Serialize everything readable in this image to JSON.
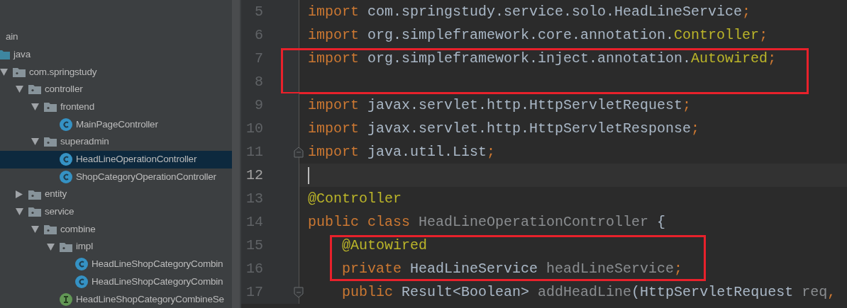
{
  "project_tree": {
    "items": [
      {
        "kind": "folder",
        "label": "ain",
        "selected": false,
        "children": [
          {
            "kind": "source-root",
            "label": "java",
            "selected": false,
            "children": [
              {
                "kind": "package",
                "label": "com.springstudy",
                "expanded": true,
                "selected": false,
                "children": [
                  {
                    "kind": "package",
                    "label": "controller",
                    "expanded": true,
                    "selected": false,
                    "children": [
                      {
                        "kind": "package",
                        "label": "frontend",
                        "expanded": true,
                        "selected": false,
                        "children": [
                          {
                            "kind": "class",
                            "label": "MainPageController",
                            "selected": false
                          }
                        ]
                      },
                      {
                        "kind": "package",
                        "label": "superadmin",
                        "expanded": true,
                        "selected": false,
                        "children": [
                          {
                            "kind": "class",
                            "label": "HeadLineOperationController",
                            "selected": true
                          },
                          {
                            "kind": "class",
                            "label": "ShopCategoryOperationController",
                            "selected": false
                          }
                        ]
                      }
                    ]
                  },
                  {
                    "kind": "package",
                    "label": "entity",
                    "expanded": false,
                    "selected": false
                  },
                  {
                    "kind": "package",
                    "label": "service",
                    "expanded": true,
                    "selected": false,
                    "children": [
                      {
                        "kind": "package",
                        "label": "combine",
                        "expanded": true,
                        "selected": false,
                        "children": [
                          {
                            "kind": "package",
                            "label": "impl",
                            "expanded": true,
                            "selected": false,
                            "children": [
                              {
                                "kind": "class",
                                "label": "HeadLineShopCategoryCombin",
                                "selected": false
                              },
                              {
                                "kind": "class",
                                "label": "HeadLineShopCategoryCombin",
                                "selected": false
                              }
                            ]
                          },
                          {
                            "kind": "interface",
                            "label": "HeadLineShopCategoryCombineSe",
                            "selected": false
                          }
                        ]
                      }
                    ]
                  }
                ]
              }
            ]
          }
        ]
      }
    ]
  },
  "editor": {
    "blocks": [
      {
        "kind": "line",
        "number": "5",
        "current": false,
        "fold": false,
        "tokens": [
          {
            "kind": "keyword",
            "text": "import"
          },
          {
            "kind": "plain",
            "text": " com.springstudy.service.solo.HeadLineService"
          },
          {
            "kind": "keyword",
            "text": ";"
          }
        ]
      },
      {
        "kind": "line",
        "number": "6",
        "current": false,
        "fold": false,
        "tokens": [
          {
            "kind": "keyword",
            "text": "import"
          },
          {
            "kind": "plain",
            "text": " org.simpleframework.core.annotation."
          },
          {
            "kind": "annotation",
            "text": "Controller"
          },
          {
            "kind": "keyword",
            "text": ";"
          }
        ]
      },
      {
        "kind": "highlight",
        "lines": [
          {
            "number": "7",
            "current": false,
            "fold": false,
            "tokens": [
              {
                "kind": "keyword",
                "text": "import"
              },
              {
                "kind": "plain",
                "text": " org.simpleframework.inject.annotation."
              },
              {
                "kind": "annotation",
                "text": "Autowired"
              },
              {
                "kind": "keyword",
                "text": ";"
              }
            ]
          },
          {
            "number": "8",
            "current": false,
            "fold": false
          }
        ]
      },
      {
        "kind": "line",
        "number": "9",
        "current": false,
        "fold": false,
        "tokens": [
          {
            "kind": "keyword",
            "text": "import"
          },
          {
            "kind": "plain",
            "text": " javax.servlet.http.HttpServletRequest"
          },
          {
            "kind": "keyword",
            "text": ";"
          }
        ]
      },
      {
        "kind": "line",
        "number": "10",
        "current": false,
        "fold": false,
        "tokens": [
          {
            "kind": "keyword",
            "text": "import"
          },
          {
            "kind": "plain",
            "text": " javax.servlet.http.HttpServletResponse"
          },
          {
            "kind": "keyword",
            "text": ";"
          }
        ]
      },
      {
        "kind": "line",
        "number": "11",
        "current": false,
        "fold": true,
        "tokens": [
          {
            "kind": "keyword",
            "text": "import"
          },
          {
            "kind": "plain",
            "text": " java.util.List"
          },
          {
            "kind": "keyword",
            "text": ";"
          }
        ]
      },
      {
        "kind": "line",
        "number": "12",
        "current": true,
        "fold": false
      },
      {
        "kind": "line",
        "number": "13",
        "current": false,
        "fold": false,
        "tokens": [
          {
            "kind": "annotation",
            "text": "@Controller"
          }
        ]
      },
      {
        "kind": "line",
        "number": "14",
        "current": false,
        "fold": false,
        "tokens": [
          {
            "kind": "keyword",
            "text": "public class"
          },
          {
            "kind": "unused",
            "text": " HeadLineOperationController"
          },
          {
            "kind": "plain",
            "text": " {"
          }
        ]
      },
      {
        "kind": "highlight",
        "lines": [
          {
            "number": "15",
            "current": false,
            "fold": false,
            "tokens": [
              {
                "kind": "annotation",
                "text": "    @Autowired"
              }
            ]
          },
          {
            "number": "16",
            "current": false,
            "fold": false,
            "tokens": [
              {
                "kind": "keyword",
                "text": "    private"
              },
              {
                "kind": "plain",
                "text": " HeadLineService "
              },
              {
                "kind": "unused",
                "text": "headLineService"
              },
              {
                "kind": "keyword",
                "text": ";"
              }
            ]
          }
        ]
      },
      {
        "kind": "line",
        "number": "17",
        "current": false,
        "fold": true,
        "tokens": [
          {
            "kind": "keyword",
            "text": "    public"
          },
          {
            "kind": "plain",
            "text": " Result<Boolean> "
          },
          {
            "kind": "unused",
            "text": "addHeadLine"
          },
          {
            "kind": "plain",
            "text": "(HttpServletRequest "
          },
          {
            "kind": "unused",
            "text": "req"
          },
          {
            "kind": "keyword",
            "text": ","
          }
        ]
      }
    ]
  }
}
